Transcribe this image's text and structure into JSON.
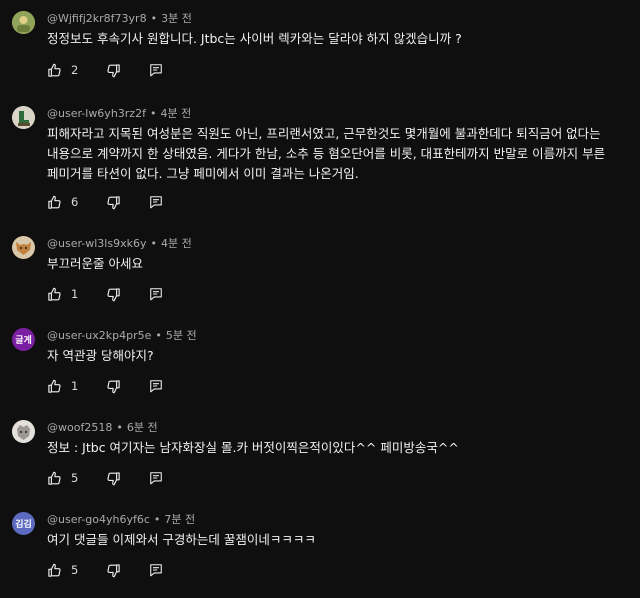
{
  "comments": [
    {
      "handle": "@Wjfifj2kr8f73yr8",
      "time": "3분 전",
      "avatar": {
        "kind": "image",
        "color": "#c9b24a",
        "label": ""
      },
      "lines": [
        "정정보도 후속기사 원합니다. Jtbc는 사이버 렉카와는 달라야 하지 않겠습니까 ?"
      ],
      "likes": "2"
    },
    {
      "handle": "@user-lw6yh3rz2f",
      "time": "4분 전",
      "avatar": {
        "kind": "image",
        "color": "#2f6b3b",
        "label": ""
      },
      "lines": [
        "피해자라고 지목된 여성분은 직원도 아닌, 프리랜서였고, 근무한것도 몇개월에 불과한데다 퇴직금어 없다는",
        "내용으로 계약까지 한 상태였음. 게다가 한남, 소추 등 혐오단어를 비롯, 대표한테까지 반말로 이름까지 부른",
        "페미거를 타션이 없다. 그냥 페미에서 이미 결과는 나온거임."
      ],
      "likes": "6"
    },
    {
      "handle": "@user-wl3ls9xk6y",
      "time": "4분 전",
      "avatar": {
        "kind": "image",
        "color": "#b9894f",
        "label": ""
      },
      "lines": [
        "부끄러운줄 아세요"
      ],
      "likes": "1"
    },
    {
      "handle": "@user-ux2kp4pr5e",
      "time": "5분 전",
      "avatar": {
        "kind": "text",
        "color": "#7b1fa2",
        "label": "글게"
      },
      "lines": [
        "자 역관광 당해야지?"
      ],
      "likes": "1"
    },
    {
      "handle": "@woof2518",
      "time": "6분 전",
      "avatar": {
        "kind": "image",
        "color": "#c7c2bd",
        "label": ""
      },
      "lines": [
        "정보 : Jtbc 여기자는 남자화장실 몰.카 버젓이찍은적이있다^^ 페미방송국^^"
      ],
      "likes": "5"
    },
    {
      "handle": "@user-go4yh6yf6c",
      "time": "7분 전",
      "avatar": {
        "kind": "text",
        "color": "#5c6bc0",
        "label": "김김"
      },
      "lines": [
        "여기 댓글들 이제와서 구경하는데 꿀잼이네ㅋㅋㅋㅋ"
      ],
      "likes": "5"
    }
  ],
  "icons": {
    "like": "thumbs-up-icon",
    "dislike": "thumbs-down-icon",
    "reply": "reply-icon"
  },
  "colors": {
    "background": "#0f0f0f",
    "text": "#f1f1f1",
    "meta": "#aaaaaa"
  }
}
